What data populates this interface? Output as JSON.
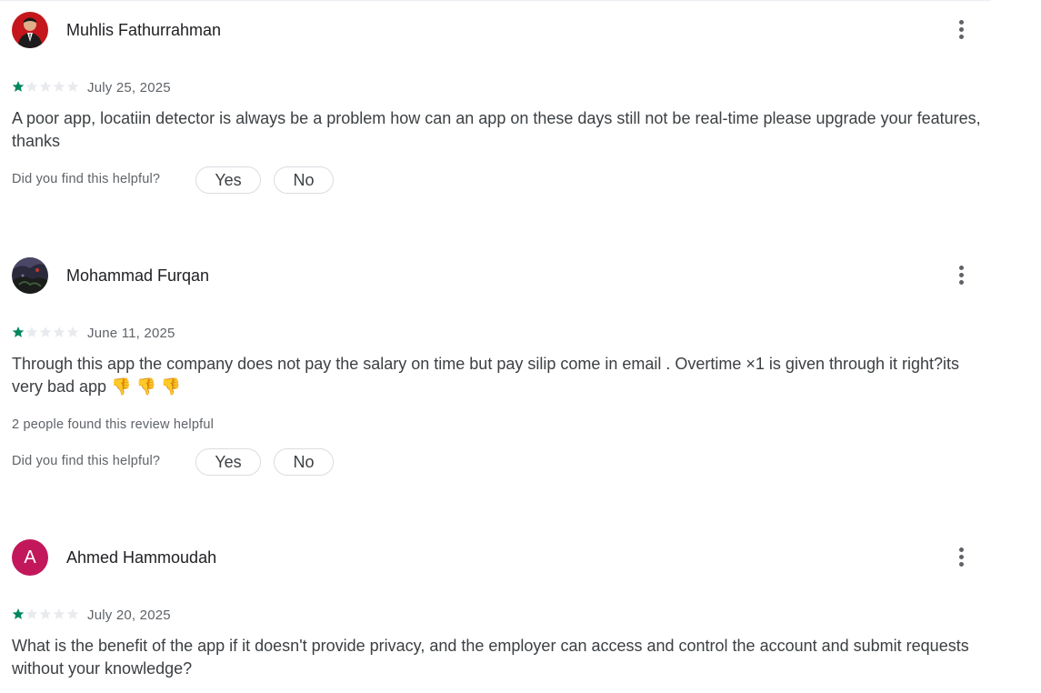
{
  "reviews": [
    {
      "author": "Muhlis Fathurrahman",
      "avatar": "photo-man-red-background",
      "rating": 1,
      "max_rating": 5,
      "date": "July 25, 2025",
      "text": "A poor app, locatiin detector is always be a problem how can an app on these days still not be real-time please upgrade your features, thanks",
      "helpful_question": "Did you find this helpful?",
      "yes_label": "Yes",
      "no_label": "No"
    },
    {
      "author": "Mohammad Furqan",
      "avatar": "photo-dark-landscape",
      "rating": 1,
      "max_rating": 5,
      "date": "June 11, 2025",
      "text": "Through this app the company does not pay the salary on time but pay silip come in email . Overtime ×1 is given through it right?its very bad app 👎 👎 👎",
      "helpful_count_text": "2 people found this review helpful",
      "helpful_question": "Did you find this helpful?",
      "yes_label": "Yes",
      "no_label": "No"
    },
    {
      "author": "Ahmed Hammoudah",
      "avatar_letter": "A",
      "avatar_color": "#c2185b",
      "rating": 1,
      "max_rating": 5,
      "date": "July 20, 2025",
      "text": "What is the benefit of the app if it doesn't provide privacy, and the employer can access and control the account and submit requests without your knowledge?"
    }
  ],
  "colors": {
    "star_filled": "#01875f",
    "star_empty": "#e8eaed",
    "text_primary": "#202124",
    "text_secondary": "#5f6368"
  },
  "icons": {
    "more": "more-vert-icon",
    "star": "star-icon"
  }
}
